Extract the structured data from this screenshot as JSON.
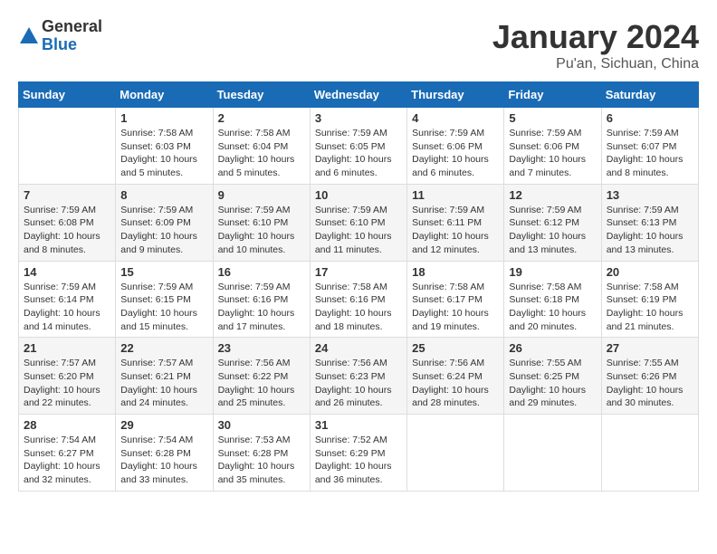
{
  "logo": {
    "general": "General",
    "blue": "Blue"
  },
  "header": {
    "month": "January 2024",
    "location": "Pu'an, Sichuan, China"
  },
  "weekdays": [
    "Sunday",
    "Monday",
    "Tuesday",
    "Wednesday",
    "Thursday",
    "Friday",
    "Saturday"
  ],
  "weeks": [
    [
      {
        "day": "",
        "info": ""
      },
      {
        "day": "1",
        "info": "Sunrise: 7:58 AM\nSunset: 6:03 PM\nDaylight: 10 hours\nand 5 minutes."
      },
      {
        "day": "2",
        "info": "Sunrise: 7:58 AM\nSunset: 6:04 PM\nDaylight: 10 hours\nand 5 minutes."
      },
      {
        "day": "3",
        "info": "Sunrise: 7:59 AM\nSunset: 6:05 PM\nDaylight: 10 hours\nand 6 minutes."
      },
      {
        "day": "4",
        "info": "Sunrise: 7:59 AM\nSunset: 6:06 PM\nDaylight: 10 hours\nand 6 minutes."
      },
      {
        "day": "5",
        "info": "Sunrise: 7:59 AM\nSunset: 6:06 PM\nDaylight: 10 hours\nand 7 minutes."
      },
      {
        "day": "6",
        "info": "Sunrise: 7:59 AM\nSunset: 6:07 PM\nDaylight: 10 hours\nand 8 minutes."
      }
    ],
    [
      {
        "day": "7",
        "info": "Sunrise: 7:59 AM\nSunset: 6:08 PM\nDaylight: 10 hours\nand 8 minutes."
      },
      {
        "day": "8",
        "info": "Sunrise: 7:59 AM\nSunset: 6:09 PM\nDaylight: 10 hours\nand 9 minutes."
      },
      {
        "day": "9",
        "info": "Sunrise: 7:59 AM\nSunset: 6:10 PM\nDaylight: 10 hours\nand 10 minutes."
      },
      {
        "day": "10",
        "info": "Sunrise: 7:59 AM\nSunset: 6:10 PM\nDaylight: 10 hours\nand 11 minutes."
      },
      {
        "day": "11",
        "info": "Sunrise: 7:59 AM\nSunset: 6:11 PM\nDaylight: 10 hours\nand 12 minutes."
      },
      {
        "day": "12",
        "info": "Sunrise: 7:59 AM\nSunset: 6:12 PM\nDaylight: 10 hours\nand 13 minutes."
      },
      {
        "day": "13",
        "info": "Sunrise: 7:59 AM\nSunset: 6:13 PM\nDaylight: 10 hours\nand 13 minutes."
      }
    ],
    [
      {
        "day": "14",
        "info": "Sunrise: 7:59 AM\nSunset: 6:14 PM\nDaylight: 10 hours\nand 14 minutes."
      },
      {
        "day": "15",
        "info": "Sunrise: 7:59 AM\nSunset: 6:15 PM\nDaylight: 10 hours\nand 15 minutes."
      },
      {
        "day": "16",
        "info": "Sunrise: 7:59 AM\nSunset: 6:16 PM\nDaylight: 10 hours\nand 17 minutes."
      },
      {
        "day": "17",
        "info": "Sunrise: 7:58 AM\nSunset: 6:16 PM\nDaylight: 10 hours\nand 18 minutes."
      },
      {
        "day": "18",
        "info": "Sunrise: 7:58 AM\nSunset: 6:17 PM\nDaylight: 10 hours\nand 19 minutes."
      },
      {
        "day": "19",
        "info": "Sunrise: 7:58 AM\nSunset: 6:18 PM\nDaylight: 10 hours\nand 20 minutes."
      },
      {
        "day": "20",
        "info": "Sunrise: 7:58 AM\nSunset: 6:19 PM\nDaylight: 10 hours\nand 21 minutes."
      }
    ],
    [
      {
        "day": "21",
        "info": "Sunrise: 7:57 AM\nSunset: 6:20 PM\nDaylight: 10 hours\nand 22 minutes."
      },
      {
        "day": "22",
        "info": "Sunrise: 7:57 AM\nSunset: 6:21 PM\nDaylight: 10 hours\nand 24 minutes."
      },
      {
        "day": "23",
        "info": "Sunrise: 7:56 AM\nSunset: 6:22 PM\nDaylight: 10 hours\nand 25 minutes."
      },
      {
        "day": "24",
        "info": "Sunrise: 7:56 AM\nSunset: 6:23 PM\nDaylight: 10 hours\nand 26 minutes."
      },
      {
        "day": "25",
        "info": "Sunrise: 7:56 AM\nSunset: 6:24 PM\nDaylight: 10 hours\nand 28 minutes."
      },
      {
        "day": "26",
        "info": "Sunrise: 7:55 AM\nSunset: 6:25 PM\nDaylight: 10 hours\nand 29 minutes."
      },
      {
        "day": "27",
        "info": "Sunrise: 7:55 AM\nSunset: 6:26 PM\nDaylight: 10 hours\nand 30 minutes."
      }
    ],
    [
      {
        "day": "28",
        "info": "Sunrise: 7:54 AM\nSunset: 6:27 PM\nDaylight: 10 hours\nand 32 minutes."
      },
      {
        "day": "29",
        "info": "Sunrise: 7:54 AM\nSunset: 6:28 PM\nDaylight: 10 hours\nand 33 minutes."
      },
      {
        "day": "30",
        "info": "Sunrise: 7:53 AM\nSunset: 6:28 PM\nDaylight: 10 hours\nand 35 minutes."
      },
      {
        "day": "31",
        "info": "Sunrise: 7:52 AM\nSunset: 6:29 PM\nDaylight: 10 hours\nand 36 minutes."
      },
      {
        "day": "",
        "info": ""
      },
      {
        "day": "",
        "info": ""
      },
      {
        "day": "",
        "info": ""
      }
    ]
  ]
}
